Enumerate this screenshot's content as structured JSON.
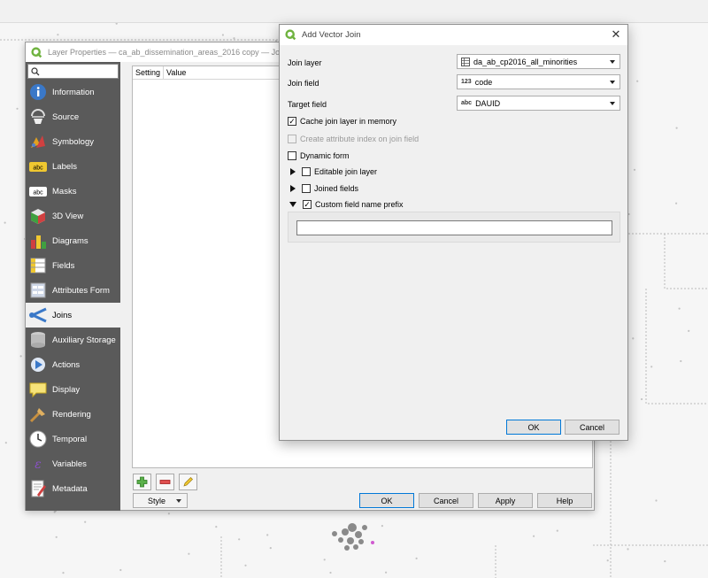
{
  "layer_properties": {
    "title": "Layer Properties — ca_ab_dissemination_areas_2016 copy — Joins",
    "nav": [
      {
        "label": "Information",
        "icon": "information-icon",
        "active": false
      },
      {
        "label": "Source",
        "icon": "source-icon",
        "active": false
      },
      {
        "label": "Symbology",
        "icon": "symbology-icon",
        "active": false
      },
      {
        "label": "Labels",
        "icon": "labels-icon",
        "active": false
      },
      {
        "label": "Masks",
        "icon": "masks-icon",
        "active": false
      },
      {
        "label": "3D View",
        "icon": "3d-view-icon",
        "active": false
      },
      {
        "label": "Diagrams",
        "icon": "diagrams-icon",
        "active": false
      },
      {
        "label": "Fields",
        "icon": "fields-icon",
        "active": false
      },
      {
        "label": "Attributes Form",
        "icon": "attributes-form-icon",
        "active": false
      },
      {
        "label": "Joins",
        "icon": "joins-icon",
        "active": true
      },
      {
        "label": "Auxiliary Storage",
        "icon": "auxiliary-storage-icon",
        "active": false
      },
      {
        "label": "Actions",
        "icon": "actions-icon",
        "active": false
      },
      {
        "label": "Display",
        "icon": "display-icon",
        "active": false
      },
      {
        "label": "Rendering",
        "icon": "rendering-icon",
        "active": false
      },
      {
        "label": "Temporal",
        "icon": "temporal-icon",
        "active": false
      },
      {
        "label": "Variables",
        "icon": "variables-icon",
        "active": false
      },
      {
        "label": "Metadata",
        "icon": "metadata-icon",
        "active": false
      }
    ],
    "table_headers": [
      "Setting",
      "Value"
    ],
    "style_label": "Style",
    "ok_label": "OK",
    "cancel_label": "Cancel",
    "apply_label": "Apply",
    "help_label": "Help"
  },
  "dialog": {
    "title": "Add Vector Join",
    "join_layer_label": "Join layer",
    "join_layer_value": "da_ab_cp2016_all_minorities",
    "join_field_label": "Join field",
    "join_field_type": "123",
    "join_field_value": "code",
    "target_field_label": "Target field",
    "target_field_type": "abc",
    "target_field_value": "DAUID",
    "cache_label": "Cache join layer in memory",
    "cache_checked": true,
    "index_label": "Create attribute index on join field",
    "dynamic_label": "Dynamic form",
    "editable_label": "Editable join layer",
    "joined_fields_label": "Joined fields",
    "prefix_label": "Custom field name prefix",
    "prefix_checked": true,
    "prefix_value": "",
    "ok_label": "OK",
    "cancel_label": "Cancel"
  },
  "colors": {
    "qgis_green": "#6fb33f",
    "sidebar_bg": "#5a5a5a",
    "accent_blue": "#0078d7"
  }
}
